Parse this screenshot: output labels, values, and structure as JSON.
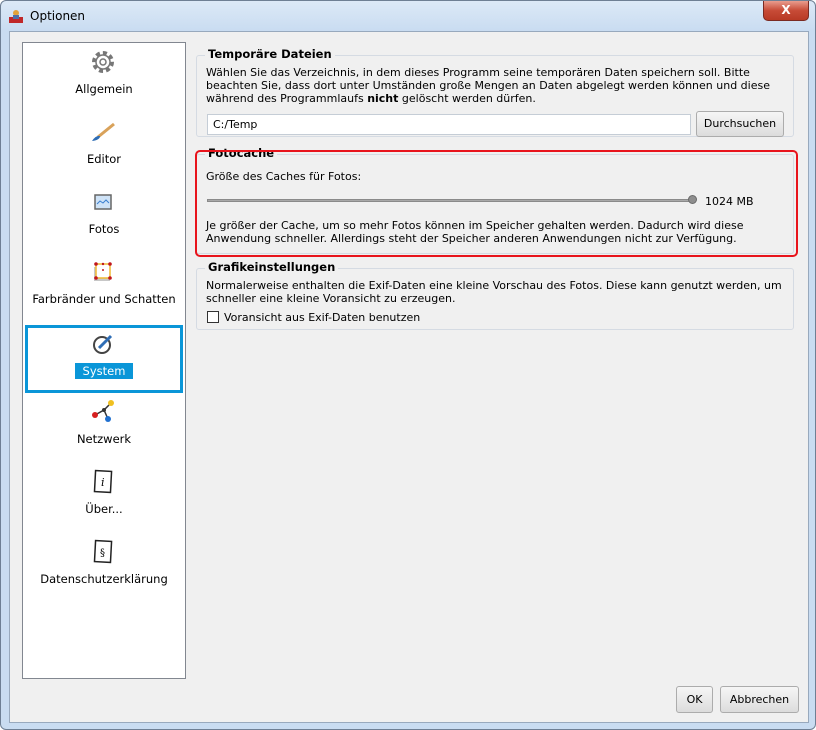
{
  "window": {
    "title": "Optionen",
    "close_label": "X"
  },
  "sidebar": {
    "items": [
      {
        "label": "Allgemein",
        "icon": "gear-icon"
      },
      {
        "label": "Editor",
        "icon": "brush-icon"
      },
      {
        "label": "Fotos",
        "icon": "photo-icon"
      },
      {
        "label": "Farbränder und Schatten",
        "icon": "frame-shadow-icon"
      },
      {
        "label": "System",
        "icon": "system-icon",
        "selected": true
      },
      {
        "label": "Netzwerk",
        "icon": "network-icon"
      },
      {
        "label": "Über...",
        "icon": "info-icon"
      },
      {
        "label": "Datenschutzerklärung",
        "icon": "privacy-icon"
      }
    ]
  },
  "temp": {
    "title": "Temporäre Dateien",
    "desc": "Wählen Sie das Verzeichnis, in dem dieses Programm seine temporären Daten speichern soll. Bitte beachten Sie, dass dort unter Umständen große Mengen an Daten abgelegt werden können und diese während des Programmlaufs ",
    "desc_bold": "nicht",
    "desc_end": " gelöscht werden dürfen.",
    "path": "C:/Temp",
    "browse": "Durchsuchen"
  },
  "cache": {
    "title": "Fotocache",
    "label": "Größe des Caches für Fotos:",
    "value": "1024 MB",
    "slider_fraction": 1.0,
    "desc": "Je größer der Cache, um so mehr Fotos können im Speicher gehalten werden. Dadurch wird diese Anwendung schneller. Allerdings steht der Speicher anderen Anwendungen nicht zur Verfügung."
  },
  "graphics": {
    "title": "Grafikeinstellungen",
    "desc": "Normalerweise enthalten die Exif-Daten eine kleine Vorschau des Fotos. Diese kann genutzt werden, um schneller eine kleine Voransicht zu erzeugen.",
    "checkbox": "Voransicht aus Exif-Daten benutzen",
    "checked": false
  },
  "footer": {
    "ok": "OK",
    "cancel": "Abbrechen"
  }
}
